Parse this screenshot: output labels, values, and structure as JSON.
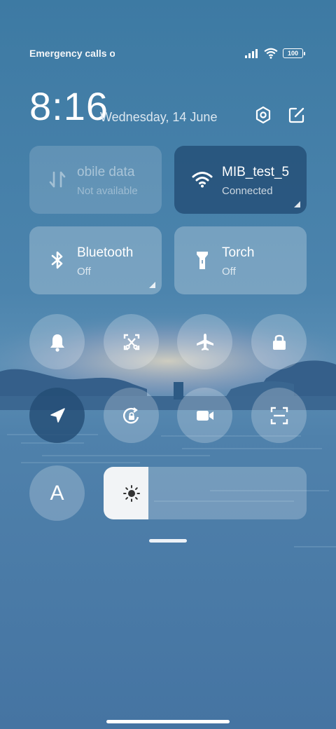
{
  "status": {
    "left_text": "Emergency calls o",
    "battery": "100"
  },
  "clock": {
    "time": "8:16",
    "date": "Wednesday, 14 June"
  },
  "tiles": [
    {
      "name": "obile data",
      "sub": "Not available"
    },
    {
      "name": "MIB_test_5",
      "sub": "Connected"
    },
    {
      "name": "Bluetooth",
      "sub": "Off"
    },
    {
      "name": "Torch",
      "sub": "Off"
    }
  ],
  "toggles_row1": [
    "bell-icon",
    "screenshot-icon",
    "airplane-icon",
    "lock-icon"
  ],
  "toggles_row2": [
    "location-icon",
    "rotation-lock-icon",
    "video-icon",
    "scanner-icon"
  ],
  "auto_brightness_label": "A",
  "brightness_level": 0.22,
  "colors": {
    "active_tile": "#2a5580",
    "brightness_fill": "#f2f4f6"
  }
}
